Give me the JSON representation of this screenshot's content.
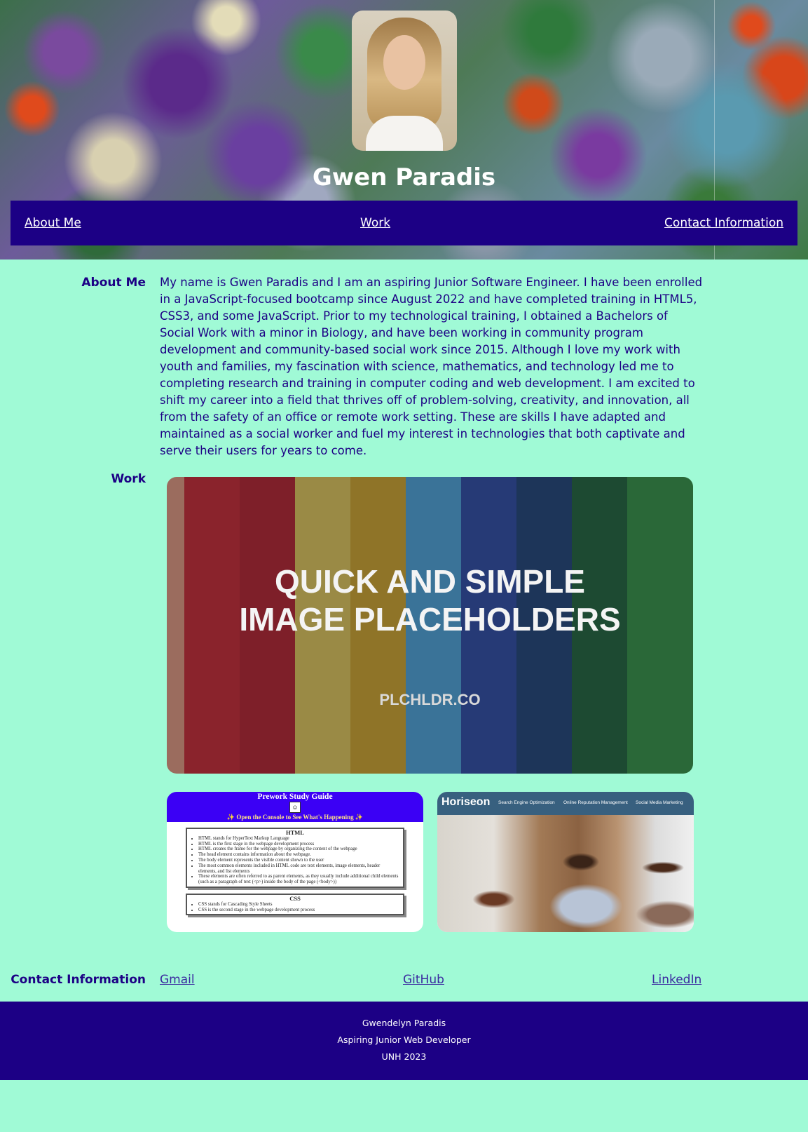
{
  "header": {
    "name": "Gwen Paradis",
    "nav": [
      "About Me",
      "Work",
      "Contact Information"
    ]
  },
  "about": {
    "heading": "About Me",
    "text": "My name is Gwen Paradis and I am an aspiring Junior Software Engineer. I have been enrolled in a JavaScript-focused bootcamp since August 2022 and have completed training in HTML5, CSS3, and some JavaScript. Prior to my technological training, I obtained a Bachelors of Social Work with a minor in Biology, and have been working in community program development and community-based social work since 2015. Although I love my work with youth and families, my fascination with science, mathematics, and technology led me to completing research and training in computer coding and web development. I am excited to shift my career into a field that thrives off of problem-solving, creativity, and innovation, all from the safety of an office or remote work setting. These are skills I have adapted and maintained as a social worker and fuel my interest in technologies that both captivate and serve their users for years to come."
  },
  "work": {
    "heading": "Work",
    "placeholder": {
      "line1": "QUICK AND SIMPLE",
      "line2": "IMAGE PLACEHOLDERS",
      "site": "PLCHLDR.CO",
      "stripes": [
        "#9b6c5e",
        "#8a232c",
        "#7e1f29",
        "#9a8a45",
        "#8f7428",
        "#3a7398",
        "#263a76",
        "#1d3559",
        "#1d4a32",
        "#2a6838"
      ]
    },
    "study_guide": {
      "title": "Prework Study Guide",
      "subtitle": "✨ Open the Console to See What's Happening ✨",
      "html_heading": "HTML",
      "html_items": [
        "HTML stands for HyperText Markup Language",
        "HTML is the first stage in the webpage development process",
        "HTML creates the frame for the webpage by organizing the content of the webpage",
        "The head element contains information about the webpage.",
        "The body element represents the visible content shown to the user",
        "The most common elements included in HTML code are text elements, image elements, header elements, and list elements",
        "These elements are often referred to as parent elements, as they usually include additional child elements (such as a paragraph of text (<p>) inside the body of the page (<body>))"
      ],
      "css_heading": "CSS",
      "css_items": [
        "CSS stands for Cascading Style Sheets",
        "CSS is the second stage in the webpage development process"
      ]
    },
    "horiseon": {
      "logo": "Horiseon",
      "nav": [
        "Search Engine Optimization",
        "Online Reputation Management",
        "Social Media Marketing"
      ]
    }
  },
  "contact": {
    "heading": "Contact Information",
    "links": [
      "Gmail",
      "GitHub",
      "LinkedIn"
    ]
  },
  "footer": {
    "name": "Gwendelyn Paradis",
    "role": "Aspiring Junior Web Developer",
    "school": "UNH 2023"
  }
}
